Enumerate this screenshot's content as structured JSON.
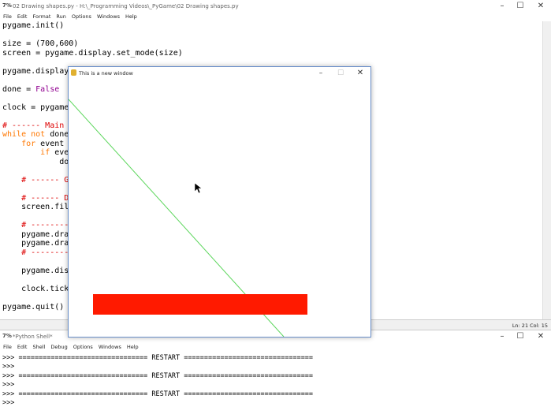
{
  "editor": {
    "title": "02 Drawing shapes.py - H:\\_Programming Videos\\_PyGame\\02 Drawing shapes.py",
    "menu": [
      "File",
      "Edit",
      "Format",
      "Run",
      "Options",
      "Windows",
      "Help"
    ],
    "status": "Ln: 21 Col: 15"
  },
  "shell": {
    "title": "*Python Shell*",
    "menu": [
      "File",
      "Edit",
      "Shell",
      "Debug",
      "Options",
      "Windows",
      "Help"
    ],
    "lines": [
      ">>> ================================ RESTART ================================",
      ">>>",
      "",
      ">>> ================================ RESTART ================================",
      ">>>",
      ">>> ================================ RESTART ================================",
      ">>>"
    ]
  },
  "pygame_window": {
    "title": "This is a new window",
    "colors": {
      "line": "#5cd65c",
      "rect": "#ff1a00"
    }
  }
}
